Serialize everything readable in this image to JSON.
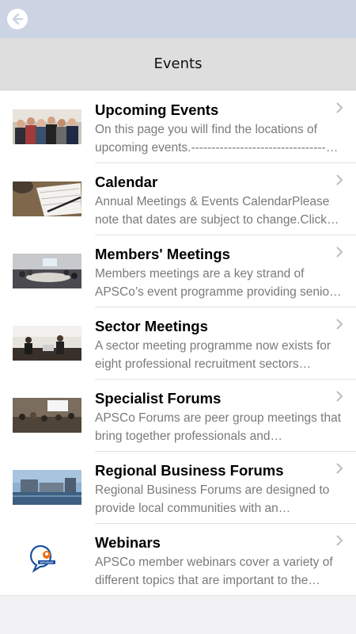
{
  "header": {
    "title": "Events"
  },
  "colors": {
    "topbar": "#ccd4e4",
    "header": "#dedede",
    "webinar_orange": "#e8731c",
    "webinar_blue": "#1a4fa0"
  },
  "items": [
    {
      "title": "Upcoming Events",
      "description": "On this page you will find the locations of upcoming events.-------------------------------------------------",
      "thumb": "crowd-photo"
    },
    {
      "title": "Calendar",
      "description": "Annual Meetings & Events CalendarPlease note that dates are subject to change.Click here to view",
      "thumb": "notebook-pen-photo"
    },
    {
      "title": "Members' Meetings",
      "description": "Members meetings are a key strand of APSCo’s event programme providing senior members with",
      "thumb": "meeting-room-photo"
    },
    {
      "title": "Sector Meetings",
      "description": "A sector meeting programme now exists for eight professional recruitment sectors…",
      "thumb": "sector-meeting-photo"
    },
    {
      "title": "Specialist Forums",
      "description": "APSCo Forums are peer group meetings that bring together professionals and…",
      "thumb": "forum-photo"
    },
    {
      "title": "Regional Business Forums",
      "description": "Regional Business Forums are designed to provide local communities with an…",
      "thumb": "waterfront-photo"
    },
    {
      "title": "Webinars",
      "description": "APSCo member webinars cover a variety of different topics that are important to the members",
      "thumb": "webinar-icon",
      "thumb_label": "WEBINAR"
    }
  ]
}
